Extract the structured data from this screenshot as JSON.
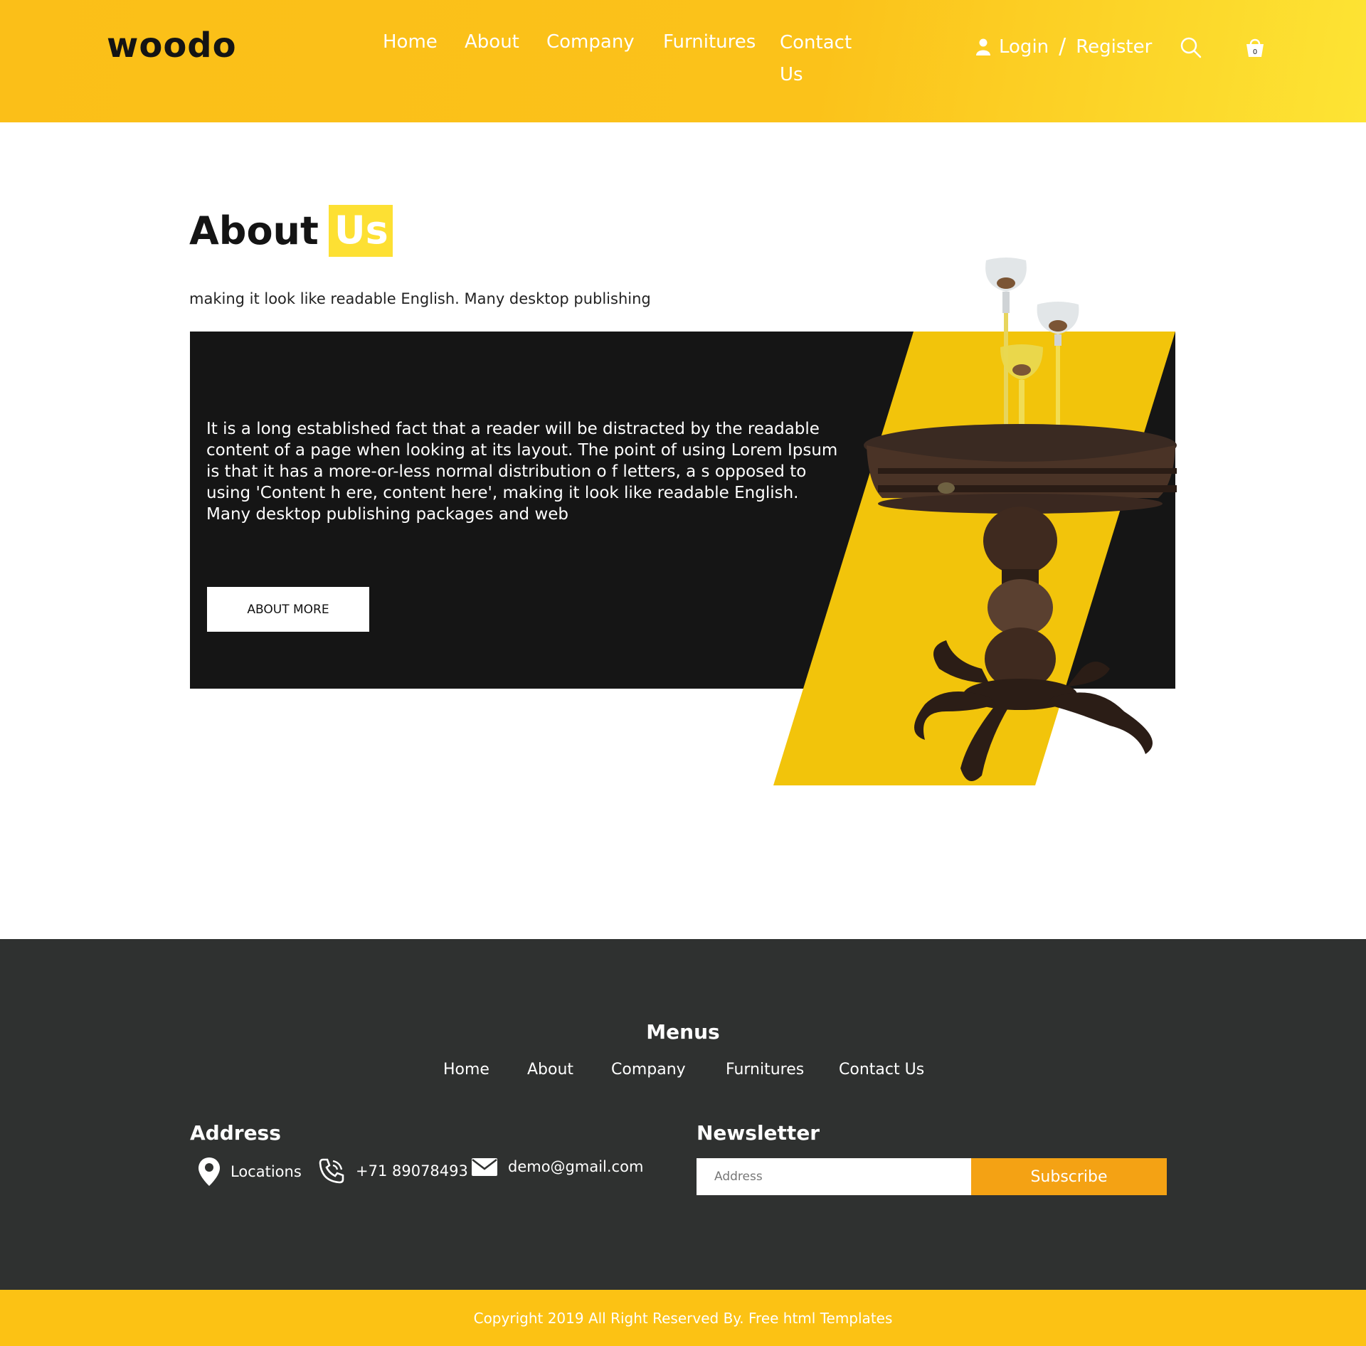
{
  "header": {
    "logo": "woodo",
    "nav": [
      "Home",
      "About",
      "Company",
      "Furnitures",
      "Contact Us"
    ],
    "login": "Login",
    "separator": "/",
    "register": "Register",
    "cart_count": "0"
  },
  "about": {
    "title": "About",
    "title_highlight": "Us",
    "subtitle": "making it look like readable English. Many desktop publishing",
    "body": "It is a long established fact that a reader will be distracted by the readable content of a page when looking at its layout. The point of using Lorem Ipsum is that it has a more-or-less normal distribution o f letters, a s opposed to using 'Content h ere, content here', making it look like readable English. Many desktop publishing packages and web",
    "button": "ABOUT MORE"
  },
  "footer": {
    "menus_title": "Menus",
    "menus": [
      "Home",
      "About",
      "Company",
      "Furnitures",
      "Contact Us"
    ],
    "address_title": "Address",
    "location": "Locations",
    "phone": "+71 89078493",
    "email": "demo@gmail.com",
    "newsletter_title": "Newsletter",
    "newsletter_placeholder": "Address",
    "subscribe": "Subscribe",
    "copyright": "Copyright 2019 All Right Reserved By. Free html Templates"
  },
  "colors": {
    "accent_yellow": "#fcc214",
    "highlight_yellow": "#fde033",
    "dark_box": "#151515",
    "footer_bg": "#2f3130",
    "subscribe_orange": "#f4a214"
  },
  "icons": [
    "user-icon",
    "search-icon",
    "cart-icon",
    "location-pin-icon",
    "phone-icon",
    "mail-icon"
  ]
}
